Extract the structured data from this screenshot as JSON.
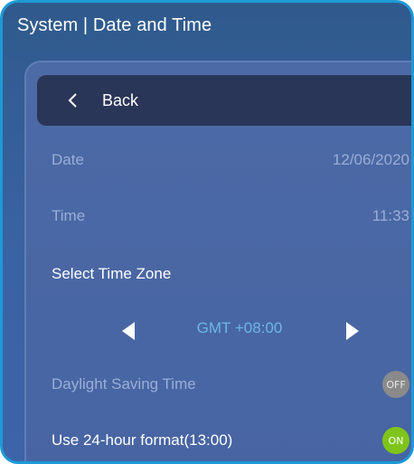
{
  "header": {
    "title": "System | Date and Time"
  },
  "back": {
    "label": "Back",
    "icon": "chevron-left-icon"
  },
  "settings": {
    "date": {
      "label": "Date",
      "value": "12/06/2020"
    },
    "time": {
      "label": "Time",
      "value": "11:33"
    },
    "timezone": {
      "label": "Select Time Zone",
      "value": "GMT +08:00",
      "prev_icon": "triangle-left-icon",
      "next_icon": "triangle-right-icon"
    },
    "dst": {
      "label": "Daylight Saving Time",
      "state": "OFF"
    },
    "format24": {
      "label": "Use 24-hour format(13:00)",
      "state": "ON"
    }
  },
  "colors": {
    "background": "#3a63a3",
    "border_accent": "#1d9ad6",
    "back_bar": "#2a3657",
    "timezone_value": "#6bb7e8",
    "toggle_on": "#7fc41a",
    "toggle_off": "#8a8a8a"
  }
}
